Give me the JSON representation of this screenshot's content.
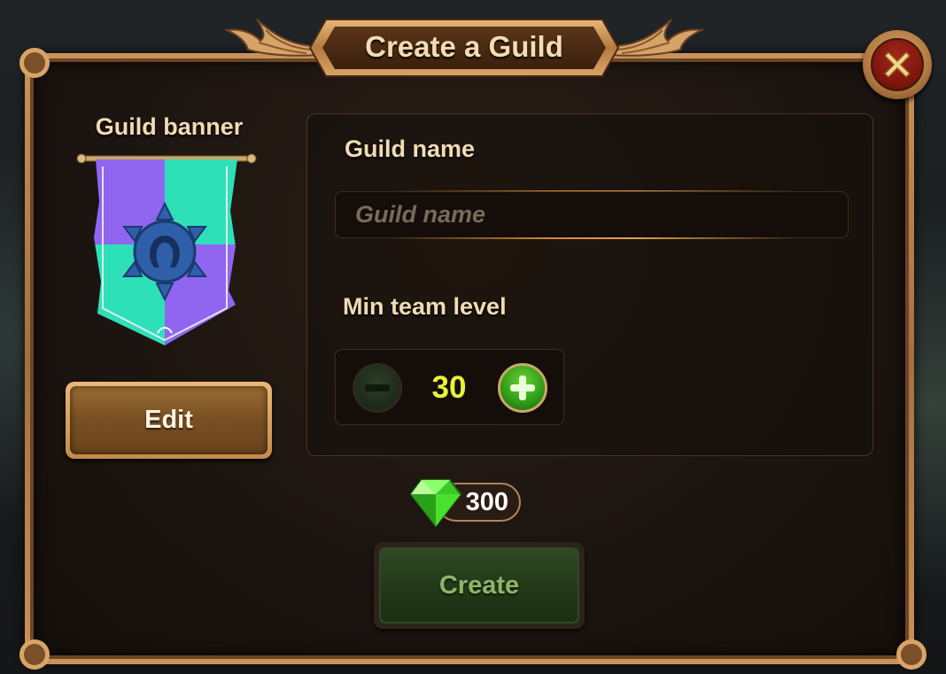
{
  "dialog": {
    "title": "Create a Guild"
  },
  "banner": {
    "label": "Guild banner",
    "colors": [
      "#9066f0",
      "#2ee0b8"
    ],
    "emblem_color": "#2f5fa8",
    "edit_label": "Edit"
  },
  "form": {
    "name_label": "Guild name",
    "name_value": "",
    "name_placeholder": "Guild name",
    "level_label": "Min team level",
    "level_value": "30"
  },
  "cost": {
    "amount": "300",
    "icon": "gem-icon"
  },
  "actions": {
    "create_label": "Create"
  },
  "icons": {
    "close": "close-icon",
    "minus": "minus-icon",
    "plus": "plus-icon"
  }
}
